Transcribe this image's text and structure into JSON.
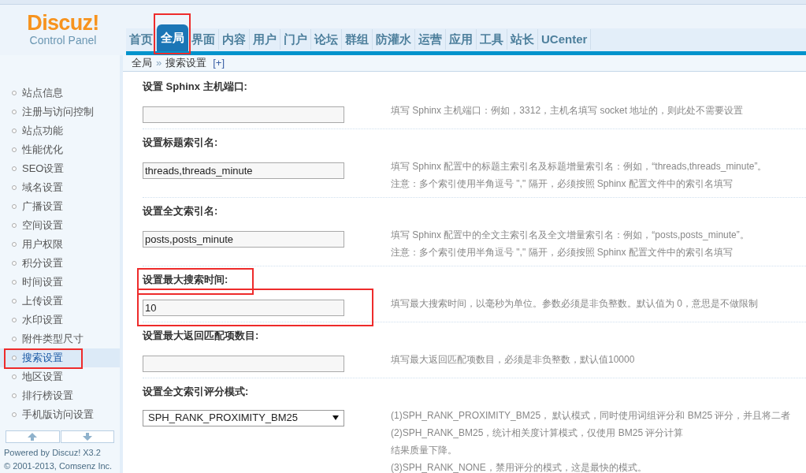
{
  "header": {
    "logo": "Discuz!",
    "subtitle": "Control Panel"
  },
  "nav": [
    {
      "label": "首页",
      "selected": false,
      "highlighted": false
    },
    {
      "label": "全局",
      "selected": true,
      "highlighted": true
    },
    {
      "label": "界面",
      "selected": false,
      "highlighted": false
    },
    {
      "label": "内容",
      "selected": false,
      "highlighted": false
    },
    {
      "label": "用户",
      "selected": false,
      "highlighted": false
    },
    {
      "label": "门户",
      "selected": false,
      "highlighted": false
    },
    {
      "label": "论坛",
      "selected": false,
      "highlighted": false
    },
    {
      "label": "群组",
      "selected": false,
      "highlighted": false
    },
    {
      "label": "防灌水",
      "selected": false,
      "highlighted": false
    },
    {
      "label": "运营",
      "selected": false,
      "highlighted": false
    },
    {
      "label": "应用",
      "selected": false,
      "highlighted": false
    },
    {
      "label": "工具",
      "selected": false,
      "highlighted": false
    },
    {
      "label": "站长",
      "selected": false,
      "highlighted": false
    },
    {
      "label": "UCenter",
      "selected": false,
      "highlighted": false
    }
  ],
  "breadcrumb": {
    "parent": "全局",
    "separator": "»",
    "current": "搜索设置",
    "add": "[+]"
  },
  "sidebar": {
    "items": [
      {
        "label": "站点信息",
        "selected": false,
        "highlighted": false
      },
      {
        "label": "注册与访问控制",
        "selected": false,
        "highlighted": false
      },
      {
        "label": "站点功能",
        "selected": false,
        "highlighted": false
      },
      {
        "label": "性能优化",
        "selected": false,
        "highlighted": false
      },
      {
        "label": "SEO设置",
        "selected": false,
        "highlighted": false
      },
      {
        "label": "域名设置",
        "selected": false,
        "highlighted": false
      },
      {
        "label": "广播设置",
        "selected": false,
        "highlighted": false
      },
      {
        "label": "空间设置",
        "selected": false,
        "highlighted": false
      },
      {
        "label": "用户权限",
        "selected": false,
        "highlighted": false
      },
      {
        "label": "积分设置",
        "selected": false,
        "highlighted": false
      },
      {
        "label": "时间设置",
        "selected": false,
        "highlighted": false
      },
      {
        "label": "上传设置",
        "selected": false,
        "highlighted": false
      },
      {
        "label": "水印设置",
        "selected": false,
        "highlighted": false
      },
      {
        "label": "附件类型尺寸",
        "selected": false,
        "highlighted": false
      },
      {
        "label": "搜索设置",
        "selected": true,
        "highlighted": true
      },
      {
        "label": "地区设置",
        "selected": false,
        "highlighted": false
      },
      {
        "label": "排行榜设置",
        "selected": false,
        "highlighted": false
      },
      {
        "label": "手机版访问设置",
        "selected": false,
        "highlighted": false
      }
    ],
    "footer": [
      "Powered by Discuz! X3.2",
      "© 2001-2013, Comsenz Inc."
    ]
  },
  "settings": [
    {
      "label": "设置 Sphinx 主机端口:",
      "kind": "input",
      "label_highlighted": false,
      "input_highlighted": false,
      "tips": [
        "填写 Sphinx 主机端口：例如，3312，主机名填写 socket 地址的，则此处不需要设置"
      ]
    },
    {
      "label": "设置标题索引名:",
      "kind": "input",
      "value": "threads,threads_minute",
      "label_highlighted": false,
      "input_highlighted": false,
      "tips": [
        "填写 Sphinx 配置中的标题主索引名及标题增量索引名：例如，“threads,threads_minute”。",
        "注意：多个索引使用半角逗号 \",\" 隔开，必须按照 Sphinx 配置文件中的索引名填写"
      ]
    },
    {
      "label": "设置全文索引名:",
      "kind": "input",
      "value": "posts,posts_minute",
      "label_highlighted": false,
      "input_highlighted": false,
      "tips": [
        "填写 Sphinx 配置中的全文主索引名及全文增量索引名：例如，“posts,posts_minute”。",
        "注意：多个索引使用半角逗号 \",\" 隔开，必须按照 Sphinx 配置文件中的索引名填写"
      ]
    },
    {
      "label": "设置最大搜索时间:",
      "kind": "input",
      "value": "10",
      "label_highlighted": true,
      "input_highlighted": true,
      "tips": [
        "填写最大搜索时间，以毫秒为单位。参数必须是非负整数。默认值为 0，意思是不做限制"
      ]
    },
    {
      "label": "设置最大返回匹配项数目:",
      "kind": "input",
      "label_highlighted": false,
      "input_highlighted": false,
      "tips": [
        "填写最大返回匹配项数目，必须是非负整数，默认值10000"
      ]
    },
    {
      "label": "设置全文索引评分模式:",
      "kind": "select",
      "value": "SPH_RANK_PROXIMITY_BM25",
      "label_highlighted": false,
      "input_highlighted": false,
      "tips": [
        "(1)SPH_RANK_PROXIMITY_BM25， 默认模式，同时使用词组评分和 BM25 评分，并且将二者",
        "(2)SPH_RANK_BM25，统计相关度计算模式，仅使用 BM25 评分计算",
        "结果质量下降。",
        "(3)SPH_RANK_NONE，禁用评分的模式，这是最快的模式。"
      ]
    }
  ]
}
